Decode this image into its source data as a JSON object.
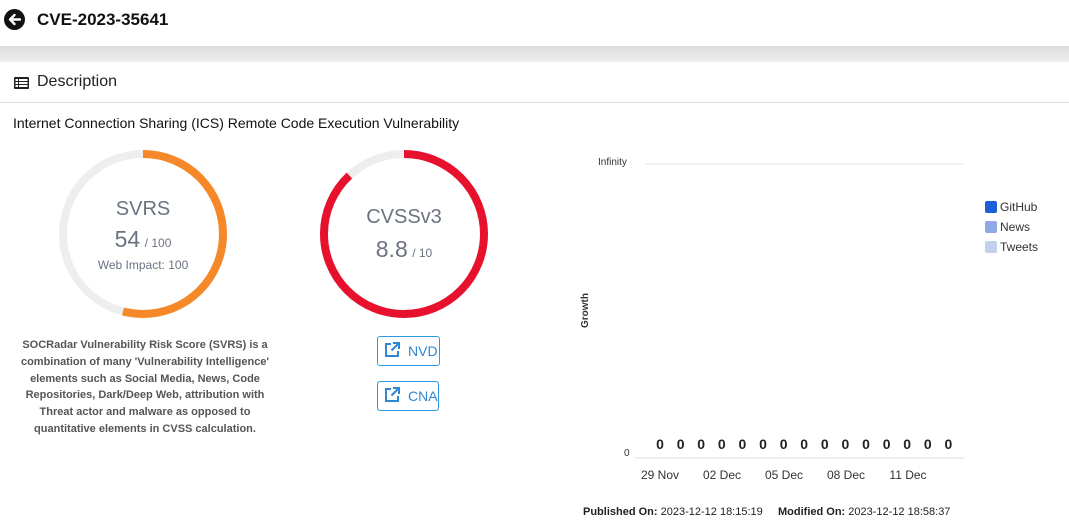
{
  "header": {
    "title": "CVE-2023-35641",
    "back_icon": "arrow-left-circle-icon"
  },
  "section": {
    "title": "Description",
    "icon": "list-icon"
  },
  "description": "Internet Connection Sharing (ICS) Remote Code Execution Vulnerability",
  "svrs": {
    "label": "SVRS",
    "score": "54",
    "max": "/ 100",
    "web_impact": "Web Impact: 100",
    "value": 54,
    "color": "#f5892a",
    "track_color": "#eeeeee",
    "explanation": "SOCRadar Vulnerability Risk Score (SVRS) is a combination of many 'Vulnerability Intelligence' elements such as Social Media, News, Code Repositories, Dark/Deep Web, attribution with Threat actor and malware as opposed to quantitative elements in CVSS calculation."
  },
  "cvss": {
    "label": "CVSSv3",
    "score": "8.8",
    "max": "/ 10",
    "value": 8.8,
    "max_value": 10,
    "color": "#e8112d",
    "track_color": "#eeeeee"
  },
  "links": {
    "nvd": {
      "label": "NVD",
      "icon": "external-link-icon"
    },
    "cna": {
      "label": "CNA",
      "icon": "external-link-icon"
    }
  },
  "chart_data": {
    "type": "bar",
    "title": "",
    "ylabel": "Growth",
    "xlabel": "",
    "y_ticks": [
      "Infinity",
      "0"
    ],
    "x_ticks": [
      "29 Nov",
      "02 Dec",
      "05 Dec",
      "08 Dec",
      "11 Dec"
    ],
    "value_labels": [
      "0",
      "0",
      "0",
      "0",
      "0",
      "0",
      "0",
      "0",
      "0",
      "0",
      "0",
      "0",
      "0",
      "0",
      "0"
    ],
    "series": [
      {
        "name": "GitHub",
        "color": "#1a5fd6",
        "values": [
          0,
          0,
          0,
          0,
          0,
          0,
          0,
          0,
          0,
          0,
          0,
          0,
          0,
          0,
          0
        ]
      },
      {
        "name": "News",
        "color": "#8fa9e6",
        "values": [
          0,
          0,
          0,
          0,
          0,
          0,
          0,
          0,
          0,
          0,
          0,
          0,
          0,
          0,
          0
        ]
      },
      {
        "name": "Tweets",
        "color": "#c3d0ee",
        "values": [
          0,
          0,
          0,
          0,
          0,
          0,
          0,
          0,
          0,
          0,
          0,
          0,
          0,
          0,
          0
        ]
      }
    ],
    "legend_position": "right"
  },
  "footer": {
    "published_label": "Published On:",
    "published_value": "2023-12-12 18:15:19",
    "modified_label": "Modified On:",
    "modified_value": "2023-12-12 18:58:37"
  }
}
